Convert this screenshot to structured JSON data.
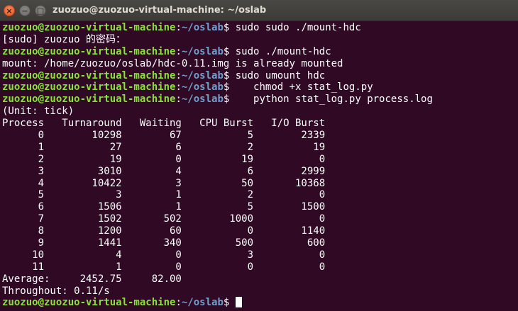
{
  "window": {
    "title": "zuozuo@zuozuo-virtual-machine: ~/oslab",
    "close_glyph": "×",
    "minimize_glyph": "−",
    "maximize_glyph": "□"
  },
  "prompt": {
    "user_host": "zuozuo@zuozuo-virtual-machine",
    "colon": ":",
    "path": "~/oslab",
    "symbol": "$"
  },
  "lines": [
    {
      "type": "prompt",
      "command": " sudo sudo ./mount-hdc"
    },
    {
      "type": "output",
      "text": "[sudo] zuozuo 的密码："
    },
    {
      "type": "prompt",
      "command": " sudo ./mount-hdc"
    },
    {
      "type": "output",
      "text": "mount: /home/zuozuo/oslab/hdc-0.11.img is already mounted"
    },
    {
      "type": "prompt",
      "command": " sudo umount hdc"
    },
    {
      "type": "prompt",
      "command": "    chmod +x stat_log.py"
    },
    {
      "type": "prompt",
      "command": "    python stat_log.py process.log"
    },
    {
      "type": "output",
      "text": "(Unit: tick)"
    },
    {
      "type": "output",
      "text": "Process   Turnaround   Waiting   CPU Burst   I/O Burst"
    },
    {
      "type": "output",
      "text": "      0        10298        67           5        2339"
    },
    {
      "type": "output",
      "text": "      1           27         6           2          19"
    },
    {
      "type": "output",
      "text": "      2           19         0          19           0"
    },
    {
      "type": "output",
      "text": "      3         3010         4           6        2999"
    },
    {
      "type": "output",
      "text": "      4        10422         3          50       10368"
    },
    {
      "type": "output",
      "text": "      5            3         1           2           0"
    },
    {
      "type": "output",
      "text": "      6         1506         1           5        1500"
    },
    {
      "type": "output",
      "text": "      7         1502       502        1000           0"
    },
    {
      "type": "output",
      "text": "      8         1200        60           0        1140"
    },
    {
      "type": "output",
      "text": "      9         1441       340         500         600"
    },
    {
      "type": "output",
      "text": "     10            4         0           3           0"
    },
    {
      "type": "output",
      "text": "     11            1         0           0           0"
    },
    {
      "type": "output",
      "text": "Average:     2452.75     82.00"
    },
    {
      "type": "output",
      "text": "Throughout: 0.11/s"
    },
    {
      "type": "prompt",
      "command": " ",
      "cursor": true
    }
  ],
  "colors": {
    "background": "#300a24",
    "user_host": "#8ae234",
    "path": "#729fcf",
    "text": "#ffffff"
  }
}
